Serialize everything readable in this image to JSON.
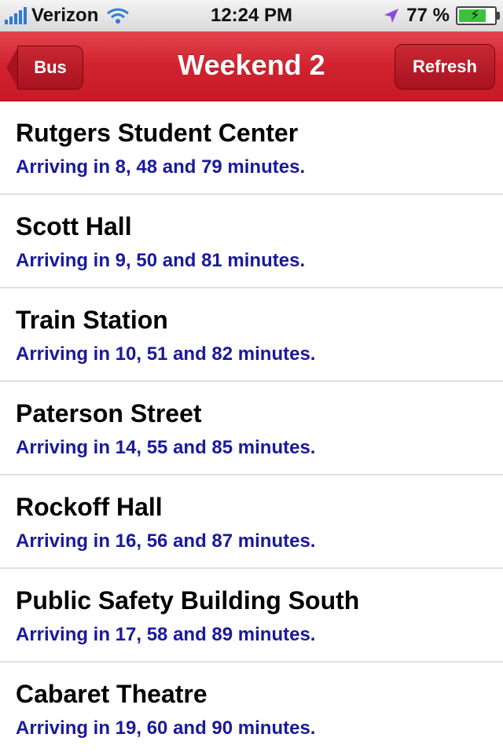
{
  "status": {
    "carrier": "Verizon",
    "time": "12:24 PM",
    "battery": "77 %",
    "battery_level": 0.77
  },
  "nav": {
    "back_label": "Bus",
    "title": "Weekend 2",
    "refresh_label": "Refresh"
  },
  "stops": [
    {
      "name": "Rutgers Student Center",
      "arrival": "Arriving in 8, 48 and 79 minutes."
    },
    {
      "name": "Scott Hall",
      "arrival": "Arriving in 9, 50 and 81 minutes."
    },
    {
      "name": "Train Station",
      "arrival": "Arriving in 10, 51 and 82 minutes."
    },
    {
      "name": "Paterson Street",
      "arrival": "Arriving in 14, 55 and 85 minutes."
    },
    {
      "name": "Rockoff Hall",
      "arrival": "Arriving in 16, 56 and 87 minutes."
    },
    {
      "name": "Public Safety Building South",
      "arrival": "Arriving in 17, 58 and 89 minutes."
    },
    {
      "name": "Cabaret Theatre",
      "arrival": "Arriving in 19, 60 and 90 minutes."
    }
  ],
  "colors": {
    "nav": "#d1232f",
    "arrival_text": "#1a1a9a"
  }
}
